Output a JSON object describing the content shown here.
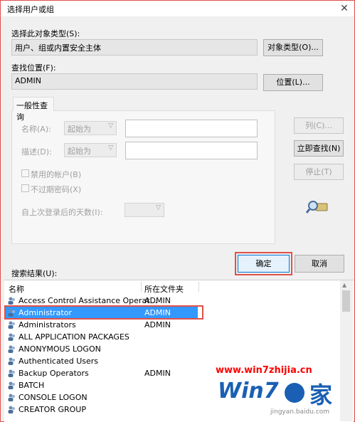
{
  "dialog": {
    "title": "选择用户或组",
    "close_glyph": "✕"
  },
  "object_type": {
    "label": "选择此对象类型(S):",
    "value": "用户、组或内置安全主体",
    "button": "对象类型(O)..."
  },
  "location": {
    "label": "查找位置(F):",
    "value": "ADMIN",
    "button": "位置(L)..."
  },
  "query": {
    "tab_label": "一般性查询",
    "name_label": "名称(A):",
    "name_match": "起始为",
    "desc_label": "描述(D):",
    "desc_match": "起始为",
    "disabled_accounts": "禁用的帐户(B)",
    "non_expiring_pw": "不过期密码(X)",
    "days_since_logon": "自上次登录后的天数(I):"
  },
  "side_buttons": {
    "columns": "列(C)...",
    "find_now": "立即查找(N)",
    "stop": "停止(T)"
  },
  "actions": {
    "ok": "确定",
    "cancel": "取消"
  },
  "results": {
    "label": "搜索结果(U):",
    "col_name": "名称",
    "col_folder": "所在文件夹",
    "rows": [
      {
        "name": "Access Control Assistance Operat...",
        "folder": "ADMIN"
      },
      {
        "name": "Administrator",
        "folder": "ADMIN",
        "selected": true
      },
      {
        "name": "Administrators",
        "folder": "ADMIN"
      },
      {
        "name": "ALL APPLICATION PACKAGES",
        "folder": ""
      },
      {
        "name": "ANONYMOUS LOGON",
        "folder": ""
      },
      {
        "name": "Authenticated Users",
        "folder": ""
      },
      {
        "name": "Backup Operators",
        "folder": "ADMIN"
      },
      {
        "name": "BATCH",
        "folder": ""
      },
      {
        "name": "CONSOLE LOGON",
        "folder": ""
      },
      {
        "name": "CREATOR GROUP",
        "folder": ""
      }
    ]
  },
  "watermark": {
    "url": "www.win7zhijia.cn",
    "logo_text": "Win7",
    "logo_suffix": "家",
    "sub": "jingyan.baidu.com"
  },
  "colors": {
    "selection": "#3399ff",
    "highlight": "#e0504a",
    "watermark_red": "#ff0000",
    "logo_blue": "#1a5fb4"
  }
}
